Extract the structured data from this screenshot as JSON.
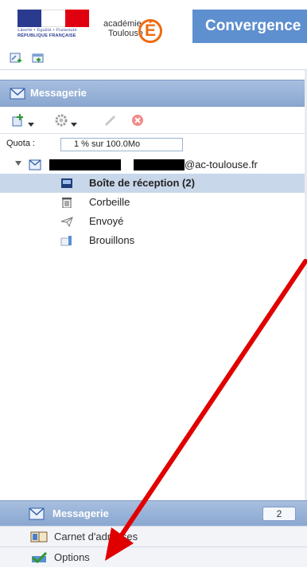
{
  "header": {
    "rf_motto": "Liberté • Égalité • Fraternité",
    "rf_name": "RÉPUBLIQUE FRANÇAISE",
    "academie_line1": "académie",
    "academie_line2": "Toulouse",
    "e_logo": "É",
    "app_title": "Convergence"
  },
  "messagerie": {
    "section_title": "Messagerie",
    "quota_label": "Quota :",
    "quota_value": "1 % sur 100.0Mo",
    "account_domain": "@ac-toulouse.fr",
    "redaction_mid": ".",
    "folders": [
      {
        "label": "Boîte de réception (2)",
        "icon": "inbox-icon",
        "selected": true
      },
      {
        "label": "Corbeille",
        "icon": "trash-icon",
        "selected": false
      },
      {
        "label": "Envoyé",
        "icon": "sent-icon",
        "selected": false
      },
      {
        "label": "Brouillons",
        "icon": "drafts-icon",
        "selected": false
      }
    ]
  },
  "bottom_nav": {
    "messagerie_label": "Messagerie",
    "messagerie_count": "2",
    "carnet_label": "Carnet d'adresses",
    "options_label": "Options"
  },
  "colors": {
    "banner": "#5e8fcf",
    "section_header": "#8aa7d0",
    "selected_row": "#c9d7ea",
    "annotation_arrow": "#e00000",
    "e_logo": "#ee6a12"
  }
}
